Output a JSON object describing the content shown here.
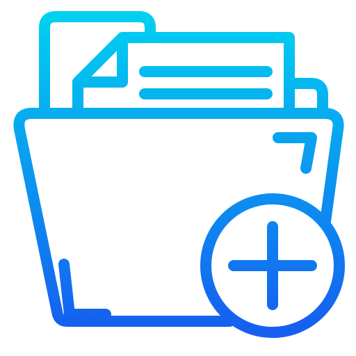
{
  "icon": {
    "name": "add-folder-icon",
    "gradient": {
      "start": "#00d2f0",
      "end": "#1560f0"
    }
  }
}
